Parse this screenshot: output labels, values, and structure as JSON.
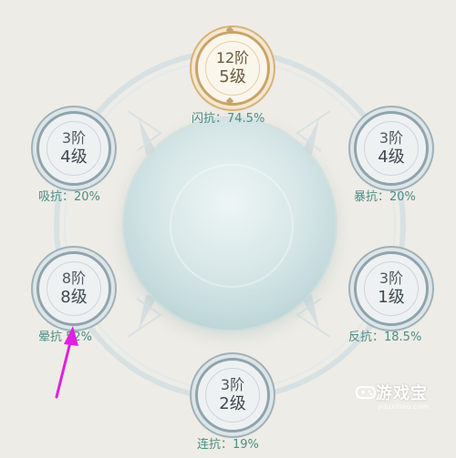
{
  "nodes": [
    {
      "id": "top",
      "tier": "12阶",
      "level": "5级",
      "label": "闪抗：74.5%",
      "gold": true
    },
    {
      "id": "upper-left",
      "tier": "3阶",
      "level": "4级",
      "label": "吸抗：20%"
    },
    {
      "id": "upper-right",
      "tier": "3阶",
      "level": "4级",
      "label": "暴抗：20%"
    },
    {
      "id": "lower-left",
      "tier": "8阶",
      "level": "8级",
      "label": "晕抗  52%"
    },
    {
      "id": "lower-right",
      "tier": "3阶",
      "level": "1级",
      "label": "反抗：18.5%"
    },
    {
      "id": "bottom",
      "tier": "3阶",
      "level": "2级",
      "label": "连抗：19%"
    }
  ],
  "watermark": {
    "name": "游戏宝",
    "sub": "youxibao.com"
  },
  "colors": {
    "label": "#4d8c86",
    "ring": "#8fa4ad",
    "gold": "#c8a46a",
    "arrow": "#e020e0",
    "background": "#eeece6"
  }
}
